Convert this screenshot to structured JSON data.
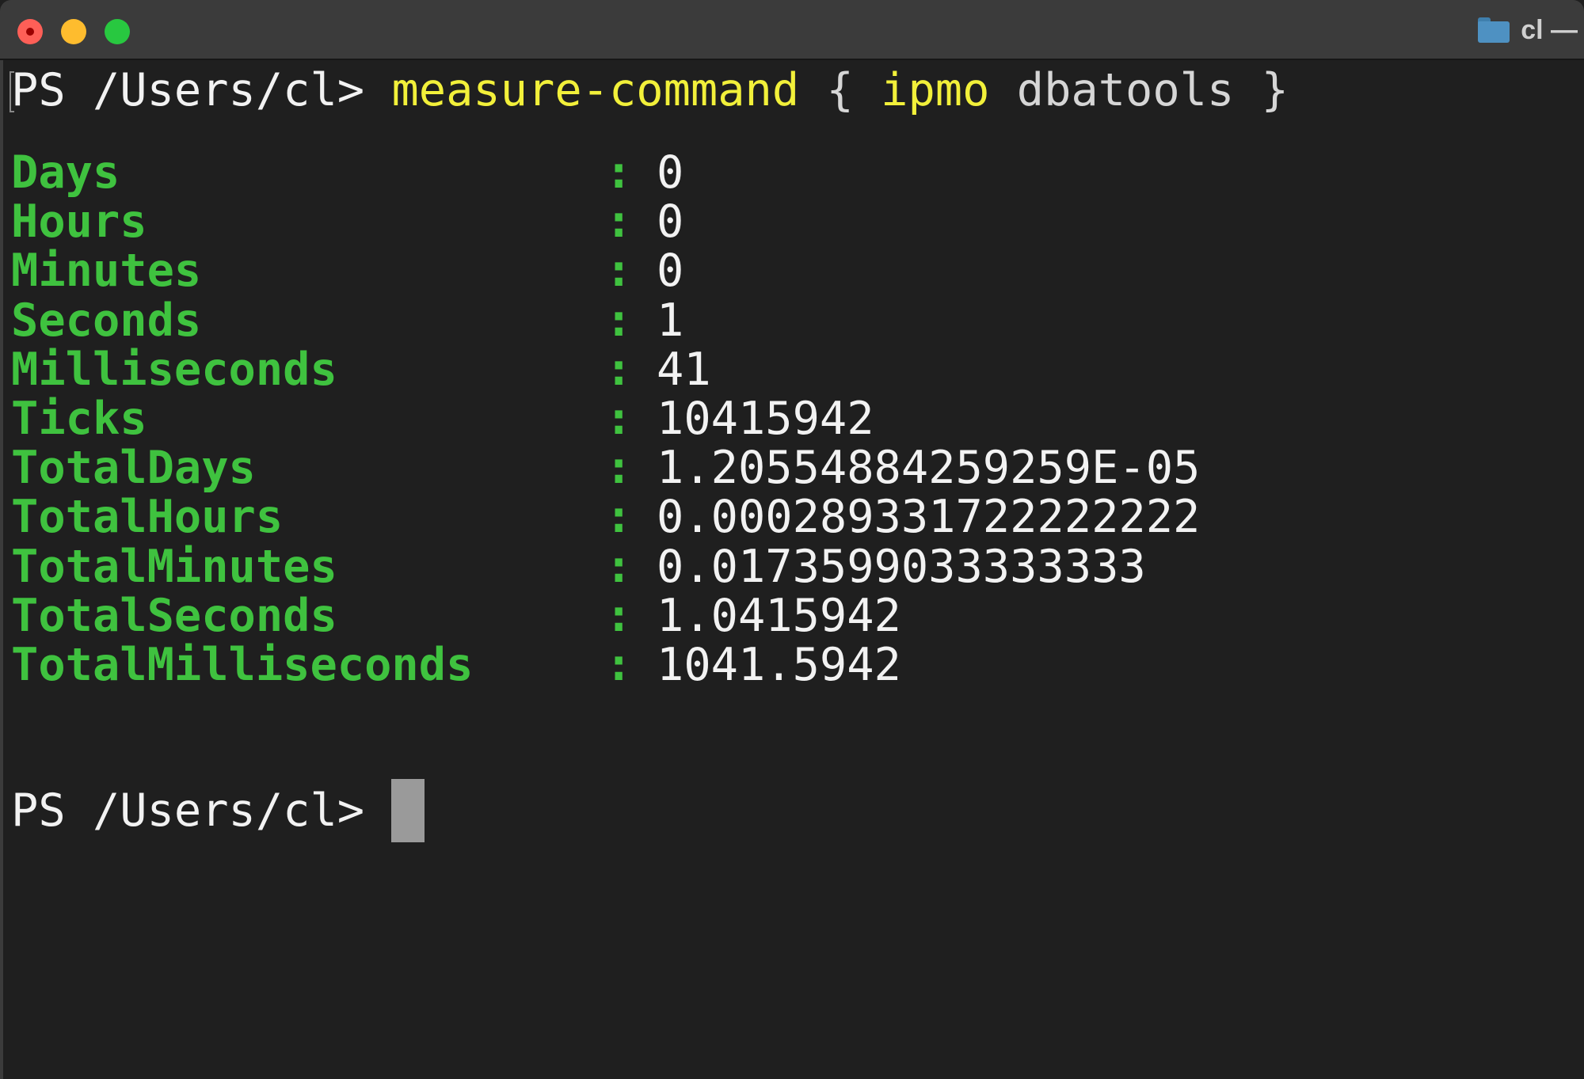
{
  "window": {
    "title": "cl —",
    "title_icon": "folder-icon",
    "controls": {
      "close": {
        "icon": "close-icon",
        "color": "#fe5f57"
      },
      "minimize": {
        "icon": "minimize-icon",
        "color": "#febc2e"
      },
      "zoom": {
        "icon": "zoom-icon",
        "color": "#28c840"
      }
    }
  },
  "terminal": {
    "command_line": {
      "prompt": "PS /Users/cl> ",
      "cmdlet": "measure-command",
      "open_brace": " { ",
      "inner_cmd": "ipmo",
      "inner_arg": " dbatools",
      "close_brace": " }"
    },
    "properties": [
      {
        "label": "Days",
        "separator": ":",
        "value": "0"
      },
      {
        "label": "Hours",
        "separator": ":",
        "value": "0"
      },
      {
        "label": "Minutes",
        "separator": ":",
        "value": "0"
      },
      {
        "label": "Seconds",
        "separator": ":",
        "value": "1"
      },
      {
        "label": "Milliseconds",
        "separator": ":",
        "value": "41"
      },
      {
        "label": "Ticks",
        "separator": ":",
        "value": "10415942"
      },
      {
        "label": "TotalDays",
        "separator": ":",
        "value": "1.20554884259259E-05"
      },
      {
        "label": "TotalHours",
        "separator": ":",
        "value": "0.000289331722222222"
      },
      {
        "label": "TotalMinutes",
        "separator": ":",
        "value": "0.0173599033333333"
      },
      {
        "label": "TotalSeconds",
        "separator": ":",
        "value": "1.0415942"
      },
      {
        "label": "TotalMilliseconds",
        "separator": ":",
        "value": "1041.5942"
      }
    ],
    "final_prompt": "PS /Users/cl> ",
    "colors": {
      "background": "#1f1f1f",
      "label": "#3fc23f",
      "value": "#f2f2f2",
      "command": "#f2f03a",
      "argument": "#d6d6d6",
      "cursor": "#9a9a9a"
    }
  }
}
